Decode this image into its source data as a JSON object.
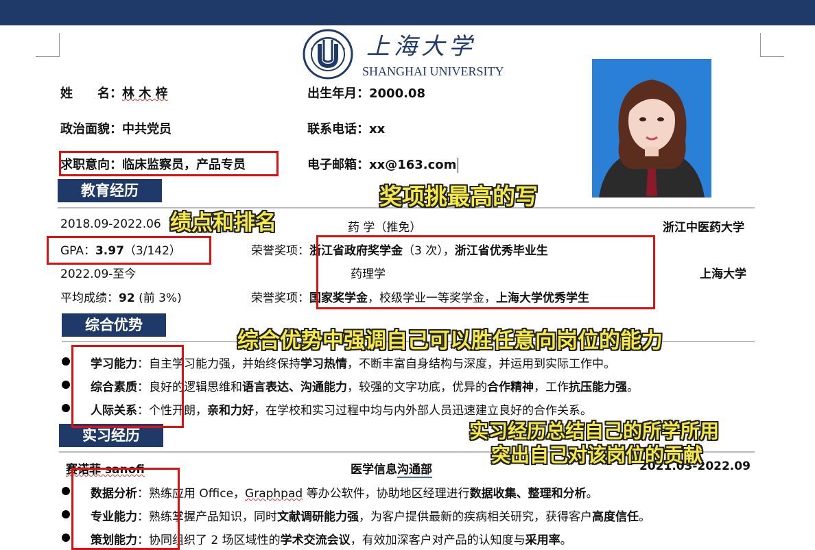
{
  "header": {
    "university_cn": "上海大学",
    "university_en": "SHANGHAI UNIVERSITY",
    "logo_ring_text": "SHANGHAI UNIVERSITY"
  },
  "personal": {
    "name_label": "姓　　名：",
    "name_value": "林 木 梓",
    "birth_label": "出生年月：",
    "birth_value": "2000.08",
    "politics_label": "政治面貌：",
    "politics_value": "中共党员",
    "phone_label": "联系电话：",
    "phone_value": "xx",
    "intent_label": "求职意向：",
    "intent_value": "临床监察员，产品专员",
    "email_label": "电子邮箱：",
    "email_value": "xx@163.com"
  },
  "sections": {
    "education": "教育经历",
    "advantages": "综合优势",
    "internship": "实习经历"
  },
  "education": [
    {
      "period": "2018.09-2022.06",
      "major": "药  学（推免）",
      "school": "浙江中医药大学",
      "score_label": "GPA：",
      "score_value": "3.97",
      "score_rank": "（3/142）",
      "honor_label": "荣誉奖项：",
      "honor_bold1": "浙江省政府奖学金",
      "honor_plain1": "（3 次），",
      "honor_bold2": "浙江省优秀毕业生",
      "honor_plain2": "",
      "honor_bold3": ""
    },
    {
      "period": "2022.09-至今",
      "major": "药理学",
      "school": "上海大学",
      "score_label": "平均成绩：",
      "score_value": "92",
      "score_rank": " (前 3%)",
      "honor_label": "荣誉奖项：",
      "honor_bold1": "国家奖学金",
      "honor_plain1": "，校级学业一等奖学金，",
      "honor_bold2": "上海大学优秀学生",
      "honor_plain2": "",
      "honor_bold3": ""
    }
  ],
  "advantages": [
    {
      "label": "学习能力",
      "parts": [
        "：自主学习能力强，并始终保持",
        "学习热情",
        "，不断丰富自身结构与深度，并运用到实际工作中。"
      ]
    },
    {
      "label": "综合素质",
      "parts": [
        "：良好的逻辑思维和",
        "语言表达、沟通能力",
        "，较强的文字功底，优异的",
        "合作精神",
        "，工作",
        "抗压能力强",
        "。"
      ]
    },
    {
      "label": "人际关系",
      "parts": [
        "：个性开朗，",
        "亲和力好",
        "，在学校和实习过程中均与内外部人员迅速建立良好的合作关系。"
      ]
    }
  ],
  "internship": {
    "company": "赛诺菲 sanofi",
    "department_a": "医学信息",
    "department_b": "沟通部",
    "period": "2021.03-2022.09",
    "items": [
      {
        "label": "数据分析",
        "parts": [
          "：熟练应用 Office，",
          "Graphpad",
          " 等办公软件，协助地区经理进行",
          "数据收集、整理和分析",
          "。"
        ]
      },
      {
        "label": "专业能力",
        "parts": [
          "：熟练掌握产品知识，同时",
          "文献调研能力强",
          "，为客户提供最新的疾病相关研究，获得客户",
          "高度信任",
          "。"
        ]
      },
      {
        "label": "策划能力",
        "parts": [
          "：协同组织了 2 场区域性的",
          "学术交流会议",
          "，有效加深客户对产品的认知度与",
          "采用率",
          "。"
        ]
      }
    ]
  },
  "annotations": {
    "awards": "奖项挑最高的写",
    "gpa": "绩点和排名",
    "advantages": "综合优势中强调自己可以胜任意向岗位的能力",
    "internship_line1": "实习经历总结自己的所学所用",
    "internship_line2": "突出自己对该岗位的贡献"
  },
  "colors": {
    "navy": "#1f3a68",
    "annotation_yellow": "#f5e94a",
    "highlight_red": "#e01010"
  }
}
